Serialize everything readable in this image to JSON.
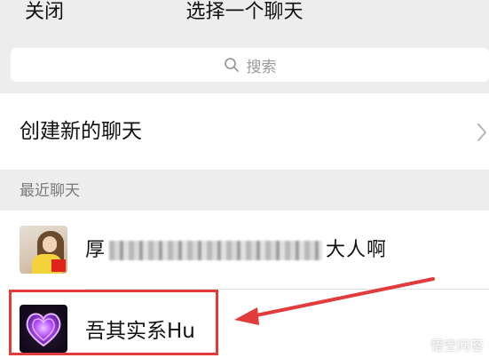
{
  "header": {
    "close_label": "关闭",
    "title": "选择一个聊天"
  },
  "search": {
    "placeholder": "搜索",
    "icon": "search-icon"
  },
  "new_chat": {
    "label": "创建新的聊天",
    "icon": "chevron-right-icon"
  },
  "recent": {
    "section_label": "最近聊天",
    "items": [
      {
        "name_start": "厚",
        "name_end": "大人啊"
      },
      {
        "name": "吾其实系Hu"
      }
    ]
  },
  "annotation": {
    "highlight_color": "#e23b3b"
  },
  "watermark": {
    "text": "悟空问答"
  }
}
